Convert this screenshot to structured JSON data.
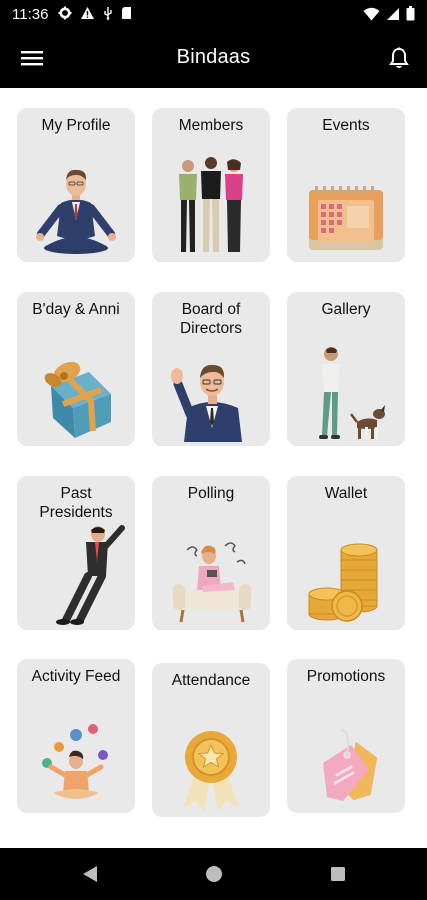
{
  "status_bar": {
    "time": "11:36",
    "left_icons": [
      "gear-icon",
      "warning-icon",
      "usb-icon",
      "sd-card-icon"
    ],
    "right_icons": [
      "wifi-icon",
      "signal-icon",
      "battery-icon"
    ]
  },
  "app_bar": {
    "title": "Bindaas",
    "menu_icon": "hamburger-menu-icon",
    "notification_icon": "bell-icon"
  },
  "tiles": [
    {
      "label": "My Profile",
      "icon": "meditating-man-illustration"
    },
    {
      "label": "Members",
      "icon": "group-of-people-illustration"
    },
    {
      "label": "Events",
      "icon": "calendar-illustration"
    },
    {
      "label": "B'day & Anni",
      "icon": "gift-box-illustration"
    },
    {
      "label": "Board of\nDirectors",
      "icon": "waving-man-illustration"
    },
    {
      "label": "Gallery",
      "icon": "man-with-dog-illustration"
    },
    {
      "label": "Past\nPresidents",
      "icon": "leaning-man-illustration"
    },
    {
      "label": "Polling",
      "icon": "thinking-woman-on-sofa-illustration"
    },
    {
      "label": "Wallet",
      "icon": "coin-stacks-illustration"
    },
    {
      "label": "Activity Feed",
      "icon": "juggling-person-illustration"
    },
    {
      "label": "Attendance",
      "icon": "award-badge-illustration"
    },
    {
      "label": "Promotions",
      "icon": "price-tags-illustration"
    }
  ],
  "nav_bar": {
    "buttons": [
      "back-icon",
      "home-icon",
      "recents-icon"
    ]
  },
  "colors": {
    "bar_background": "#000000",
    "card_background": "#e9e9ea",
    "page_background": "#ffffff"
  }
}
